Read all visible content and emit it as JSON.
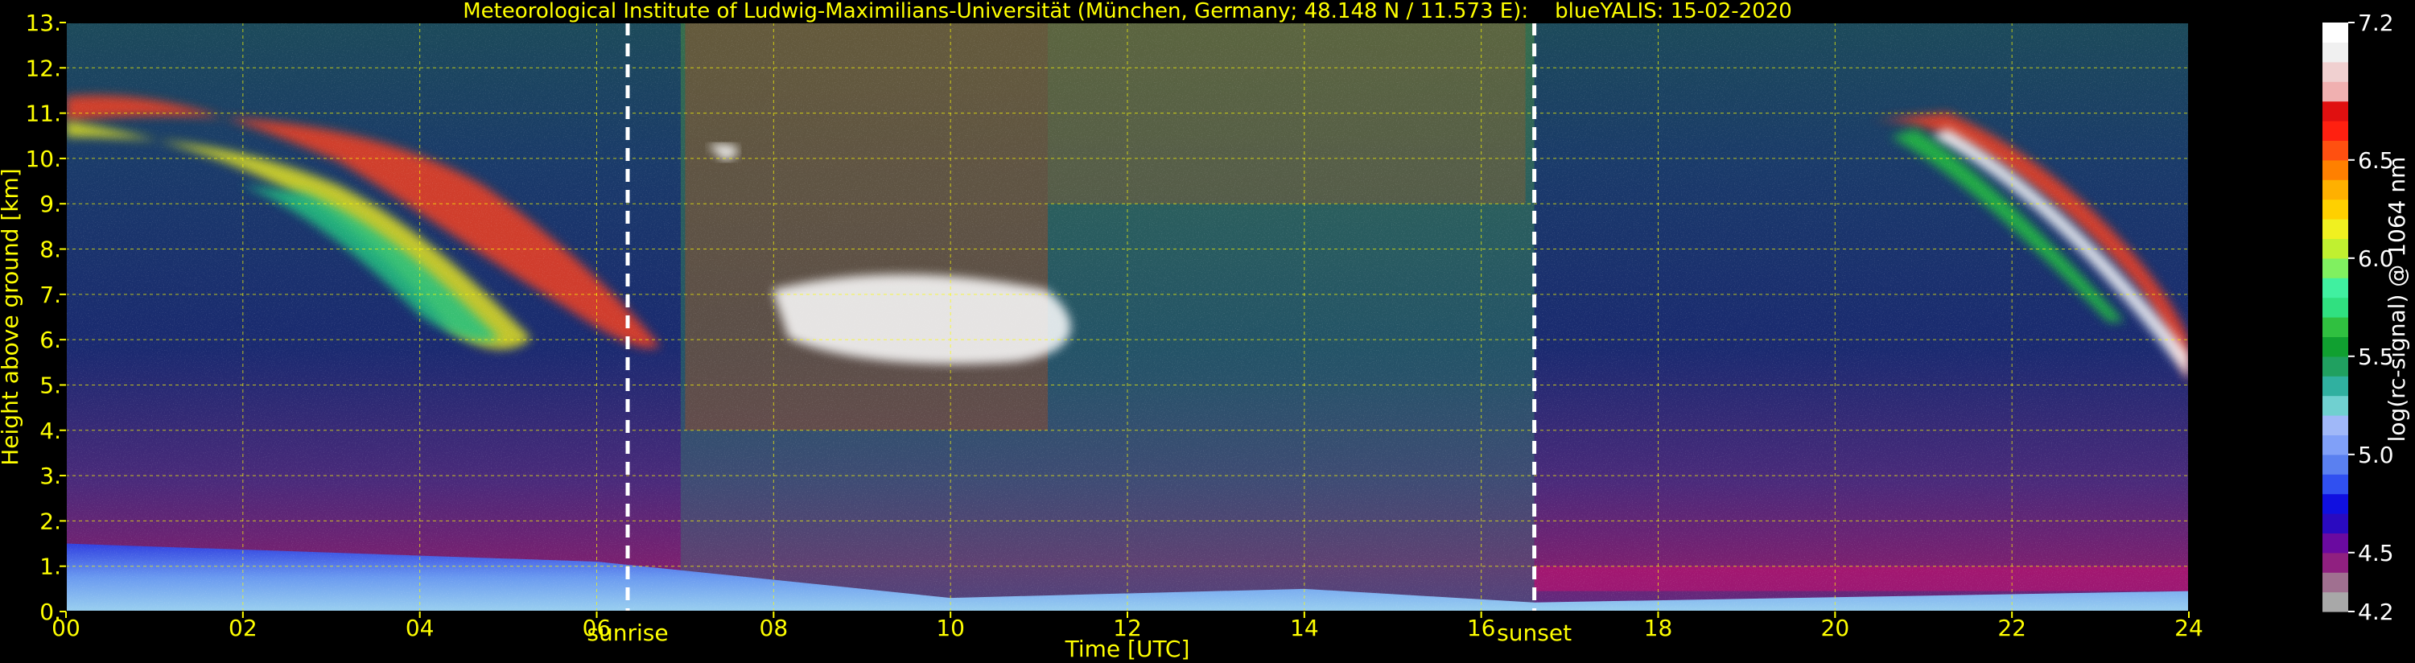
{
  "chart_data": {
    "type": "heatmap",
    "title": "Meteorological Institute of Ludwig-Maximilians-Universität (München, Germany; 48.148 N / 11.573 E):    blueYALIS: 15-02-2020",
    "xlabel": "Time [UTC]",
    "ylabel": "Height above ground [km]",
    "xlim": [
      0,
      24
    ],
    "ylim": [
      0,
      13
    ],
    "x_ticks": [
      "00",
      "02",
      "04",
      "06",
      "08",
      "10",
      "12",
      "14",
      "16",
      "18",
      "20",
      "22",
      "24"
    ],
    "y_ticks": [
      "0.",
      "1.",
      "2.",
      "3.",
      "4.",
      "5.",
      "6.",
      "7.",
      "8.",
      "9.",
      "10.",
      "11.",
      "12.",
      "13."
    ],
    "grid": true,
    "colorbar": {
      "label": "log(rc-signal) @ 1064 nm",
      "range": [
        4.2,
        7.2
      ],
      "tick_labels": [
        "4.2",
        "4.5",
        "5.0",
        "5.5",
        "6.0",
        "6.5",
        "7.2"
      ],
      "tick_values": [
        4.2,
        4.5,
        5.0,
        5.5,
        6.0,
        6.5,
        7.2
      ]
    },
    "markers": [
      {
        "label": "sunrise",
        "time": 6.35
      },
      {
        "label": "sunset",
        "time": 16.6
      }
    ]
  }
}
